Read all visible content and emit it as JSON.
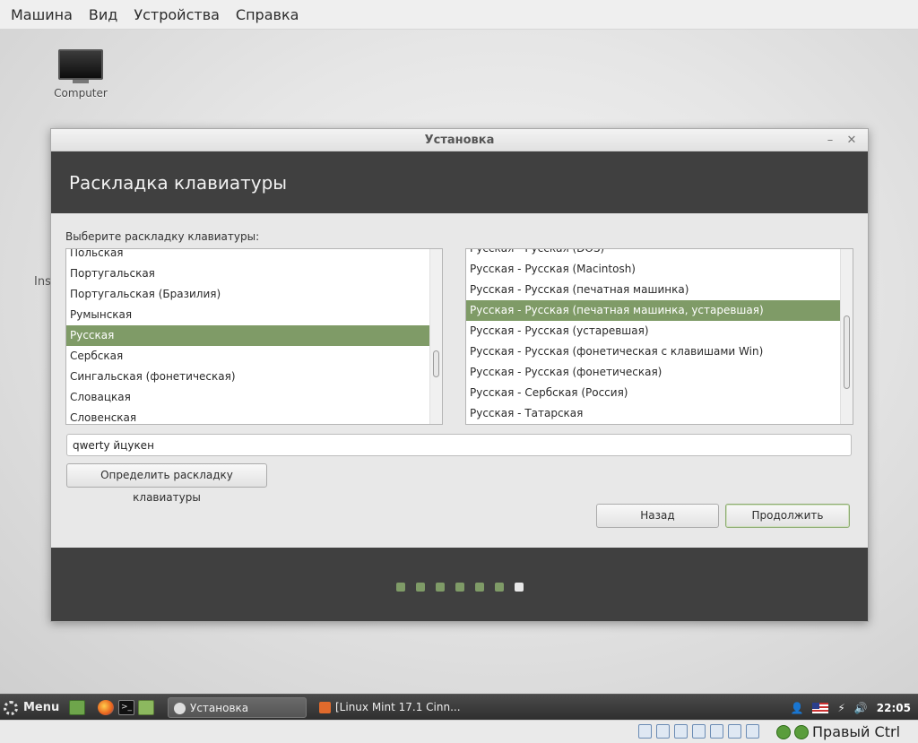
{
  "vbox_menu": [
    "Машина",
    "Вид",
    "Устройства",
    "Справка"
  ],
  "desktop": {
    "icon_label": "Computer",
    "partial_text": "Ins"
  },
  "window": {
    "title": "Установка",
    "header": "Раскладка клавиатуры",
    "prompt": "Выберите раскладку клавиатуры:",
    "layouts": [
      "Польская",
      "Португальская",
      "Португальская (Бразилия)",
      "Румынская",
      "Русская",
      "Сербская",
      "Сингальская (фонетическая)",
      "Словацкая",
      "Словенская"
    ],
    "layouts_selected": "Русская",
    "variants": [
      "Русская - Русская (DOS)",
      "Русская - Русская (Macintosh)",
      "Русская - Русская (печатная машинка)",
      "Русская - Русская (печатная машинка, устаревшая)",
      "Русская - Русская (устаревшая)",
      "Русская - Русская (фонетическая с клавишами Win)",
      "Русская - Русская (фонетическая)",
      "Русская - Сербская (Россия)",
      "Русская - Татарская"
    ],
    "variants_selected": "Русская - Русская (печатная машинка, устаревшая)",
    "test_input_value": "qwerty йцукен",
    "detect_button": "Определить раскладку клавиатуры",
    "back_button": "Назад",
    "continue_button": "Продолжить",
    "progress": {
      "total_steps": 7,
      "current_step": 7
    }
  },
  "taskbar": {
    "menu_label": "Menu",
    "tasks": [
      "Установка",
      "[Linux Mint 17.1 Cinn..."
    ],
    "clock": "22:05"
  },
  "vbox_status": {
    "host_key": "Правый Ctrl"
  },
  "colors": {
    "accent": "#7f9b67",
    "header_band": "#404040"
  }
}
